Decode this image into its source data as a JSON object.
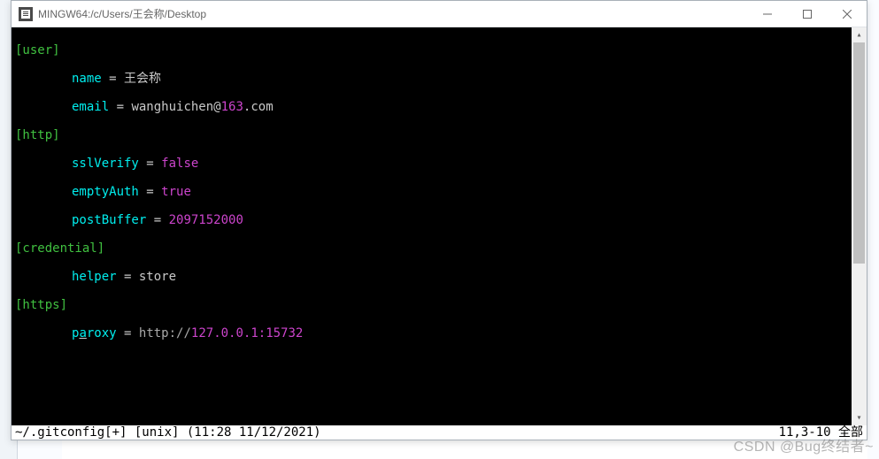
{
  "window": {
    "title": "MINGW64:/c/Users/王会称/Desktop"
  },
  "config": {
    "user_section": "[user]",
    "user_name_key": "name",
    "user_name_val": "王会称",
    "user_email_key": "email",
    "user_email_val_a": "wanghuichen@",
    "user_email_val_b": "163",
    "user_email_val_c": ".com",
    "http_section": "[http]",
    "sslverify_key": "sslVerify",
    "sslverify_val": "false",
    "emptyauth_key": "emptyAuth",
    "emptyauth_val": "true",
    "postbuffer_key": "postBuffer",
    "postbuffer_val": "2097152000",
    "cred_section": "[credential]",
    "helper_key": "helper",
    "helper_val": "store",
    "https_section": "[https]",
    "proxy_key_a": "p",
    "proxy_key_b": "a",
    "proxy_key_c": "roxy",
    "proxy_val_a": "http://",
    "proxy_val_b": "127.0.0.1:15732",
    "eq": " = "
  },
  "status": {
    "left": "~/.gitconfig[+] [unix] (11:28 11/12/2021)",
    "right": "11,3-10 全部"
  },
  "watermark": "CSDN @Bug终结者~"
}
